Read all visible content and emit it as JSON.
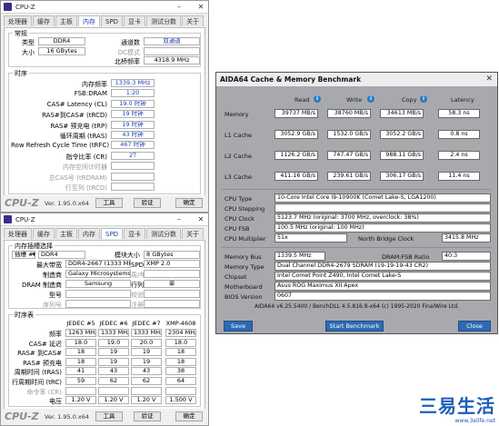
{
  "cpuz_top": {
    "title": "CPU-Z",
    "tabs": [
      "处理器",
      "缓存",
      "主板",
      "内存",
      "SPD",
      "显卡",
      "测试分数",
      "关于"
    ],
    "active_tab": "内存",
    "general": {
      "group": "常规",
      "type_label": "类型",
      "type_value": "DDR4",
      "size_label": "大小",
      "size_value": "16 GBytes",
      "channels_label": "通道数",
      "channels_value": "双通道",
      "dc_label": "DC模式",
      "dc_value": "",
      "nb_label": "北桥频率",
      "nb_value": "4318.9 MHz"
    },
    "timings": {
      "group": "时序",
      "rows": [
        {
          "label": "内存频率",
          "value": "1339.3 MHz",
          "dim": false
        },
        {
          "label": "FSB:DRAM",
          "value": "1:20",
          "dim": false
        },
        {
          "label": "CAS# Latency (CL)",
          "value": "19.0 时钟",
          "dim": false
        },
        {
          "label": "RAS#到CAS# (tRCD)",
          "value": "19 时钟",
          "dim": false
        },
        {
          "label": "RAS# 预充电 (tRP)",
          "value": "19 时钟",
          "dim": false
        },
        {
          "label": "循环周期 (tRAS)",
          "value": "43 时钟",
          "dim": false
        },
        {
          "label": "Row Refresh Cycle Time (tRFC)",
          "value": "467 时钟",
          "dim": false
        },
        {
          "label": "指令比率 (CR)",
          "value": "2T",
          "dim": false
        },
        {
          "label": "内存空闲计时器",
          "value": "",
          "dim": true
        },
        {
          "label": "总CAS号 (tRDRAM)",
          "value": "",
          "dim": true
        },
        {
          "label": "行至列 (tRCD)",
          "value": "",
          "dim": true
        }
      ]
    },
    "footer": {
      "brand": "CPU-Z",
      "version": "Ver. 1.95.0.x64",
      "tools": "工具",
      "validate": "验证",
      "ok": "确定"
    }
  },
  "cpuz_bottom": {
    "title": "CPU-Z",
    "tabs": [
      "处理器",
      "缓存",
      "主板",
      "内存",
      "SPD",
      "显卡",
      "测试分数",
      "关于"
    ],
    "active_tab": "SPD",
    "slot": {
      "group": "内存插槽选择",
      "slot_value": "插槽 #1",
      "type_value": "DDR4",
      "module_size_label": "模块大小",
      "module_size_value": "8 GBytes",
      "max_bw_label": "最大带宽",
      "max_bw_value": "DDR4-2667 (1333 MHz)",
      "spd_ext_label": "SPD扩展",
      "spd_ext_value": "XMP 2.0",
      "mfr_label": "制造商",
      "mfr_value": "Galaxy Microsystems Ltd.",
      "week_label": "周/年份",
      "week_value": "",
      "dram_mfr_label": "DRAM 制造商",
      "dram_mfr_value": "Samsung",
      "ranks_label": "行列",
      "ranks_value": "单",
      "part_label": "型号",
      "part_value": "",
      "corr_label": "校验",
      "corr_value": "",
      "serial_label": "序列号",
      "serial_value": "",
      "reg_label": "注册",
      "reg_value": ""
    },
    "table": {
      "group": "时序表",
      "columns": [
        "JEDEC #5",
        "JEDEC #6",
        "JEDEC #7",
        "XMP-4608"
      ],
      "rows": [
        {
          "label": "频率",
          "values": [
            "1263 MHz",
            "1333 MHz",
            "1333 MHz",
            "2304 MHz"
          ]
        },
        {
          "label": "CAS# 延迟",
          "values": [
            "18.0",
            "19.0",
            "20.0",
            "18.0"
          ]
        },
        {
          "label": "RAS# 到CAS#",
          "values": [
            "18",
            "19",
            "19",
            "18"
          ]
        },
        {
          "label": "RAS# 预充电",
          "values": [
            "18",
            "19",
            "19",
            "18"
          ]
        },
        {
          "label": "周期时间 (tRAS)",
          "values": [
            "41",
            "43",
            "43",
            "38"
          ]
        },
        {
          "label": "行周期时间 (tRC)",
          "values": [
            "59",
            "62",
            "62",
            "64"
          ]
        },
        {
          "label": "命令率 (CR)",
          "values": [
            "",
            "",
            "",
            ""
          ]
        },
        {
          "label": "电压",
          "values": [
            "1.20 V",
            "1.20 V",
            "1.20 V",
            "1.500 V"
          ]
        }
      ]
    },
    "footer": {
      "brand": "CPU-Z",
      "version": "Ver. 1.95.0.x64",
      "tools": "工具",
      "validate": "验证",
      "ok": "确定"
    }
  },
  "aida": {
    "title": "AIDA64 Cache & Memory Benchmark",
    "columns": [
      "Read",
      "Write",
      "Copy",
      "Latency"
    ],
    "rows": [
      {
        "label": "Memory",
        "read": "39737 MB/s",
        "write": "38760 MB/s",
        "copy": "34613 MB/s",
        "latency": "58.3 ns"
      },
      {
        "label": "L1 Cache",
        "read": "3052.9 GB/s",
        "write": "1532.0 GB/s",
        "copy": "3052.2 GB/s",
        "latency": "0.8 ns"
      },
      {
        "label": "L2 Cache",
        "read": "1126.2 GB/s",
        "write": "747.47 GB/s",
        "copy": "988.11 GB/s",
        "latency": "2.4 ns"
      },
      {
        "label": "L3 Cache",
        "read": "411.16 GB/s",
        "write": "239.61 GB/s",
        "copy": "306.17 GB/s",
        "latency": "11.4 ns"
      }
    ],
    "cpu": {
      "type_label": "CPU Type",
      "type_value": "10-Core Intel Core i9-10900K  (Comet Lake-S, LGA1200)",
      "stepping_label": "CPU Stepping",
      "stepping_value": "",
      "clock_label": "CPU Clock",
      "clock_value": "5123.7 MHz  (original: 3700 MHz, overclock: 38%)",
      "fsb_label": "CPU FSB",
      "fsb_value": "100.5 MHz  (original: 100 MHz)",
      "mult_label": "CPU Multiplier",
      "mult_value": "51x",
      "nb_label": "North Bridge Clock",
      "nb_value": "3415.8 MHz"
    },
    "mem": {
      "bus_label": "Memory Bus",
      "bus_value": "1339.5 MHz",
      "ratio_label": "DRAM:FSB Ratio",
      "ratio_value": "40:3",
      "type_label": "Memory Type",
      "type_value": "Dual Channel DDR4-2679 SDRAM  (19-19-19-43 CR2)",
      "chipset_label": "Chipset",
      "chipset_value": "Intel Comet Point Z490, Intel Comet Lake-S",
      "mb_label": "Motherboard",
      "mb_value": "Asus ROG Maximus XII Apex",
      "bios_label": "BIOS Version",
      "bios_value": "0607"
    },
    "footnote": "AIDA64 v6.25.5400 / BenchDLL 4.5.816.8-x64  (c) 1995-2020 FinalWire Ltd.",
    "buttons": {
      "save": "Save",
      "start": "Start Benchmark",
      "close": "Close"
    }
  },
  "watermark": {
    "text": "三易生活",
    "url": "www.3elife.net"
  },
  "colors": {
    "cpuz_value_blue": "#1e3fb3",
    "aida_button": "#2d6ab3",
    "watermark": "#1c5fb8"
  }
}
